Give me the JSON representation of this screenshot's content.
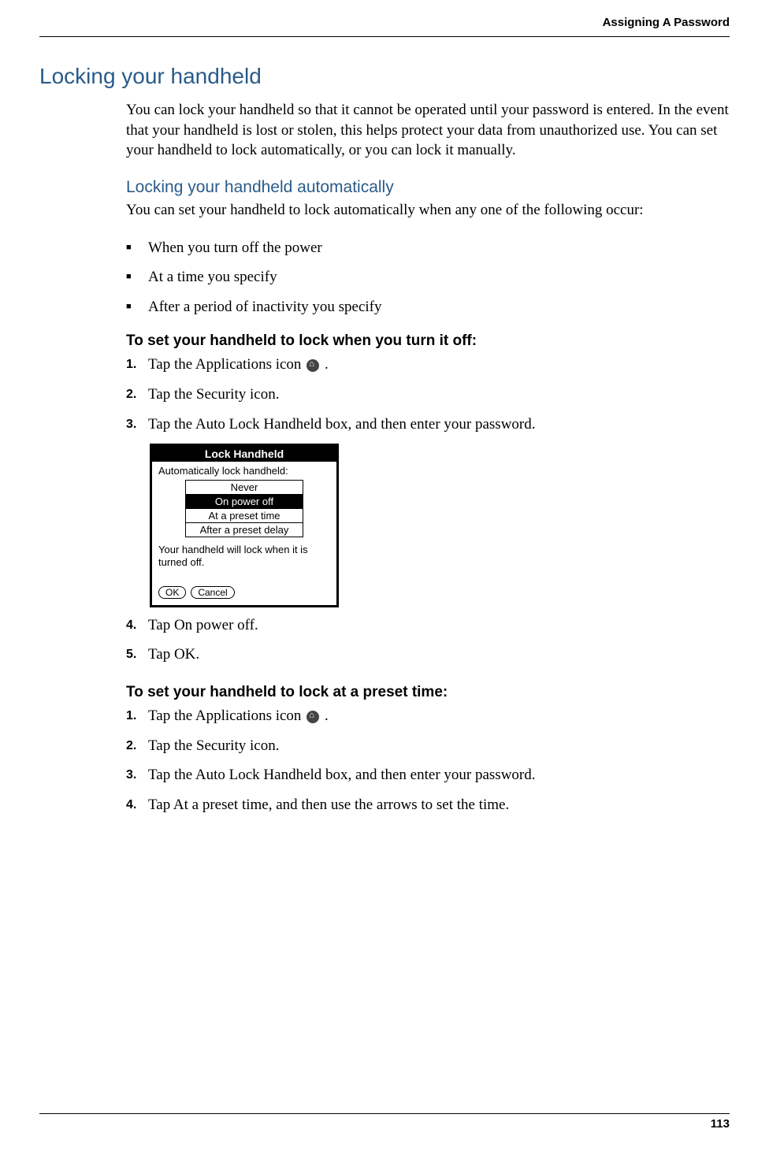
{
  "header": {
    "section_name": "Assigning A Password"
  },
  "main": {
    "title": "Locking your handheld",
    "intro": "You can lock your handheld so that it cannot be operated until your password is entered. In the event that your handheld is lost or stolen, this helps protect your data from unauthorized use. You can set your handheld to lock automatically, or you can lock it manually.",
    "auto_section": {
      "title": "Locking your handheld automatically",
      "intro": "You can set your handheld to lock automatically when any one of the following occur:",
      "bullets": [
        "When you turn off the power",
        "At a time you specify",
        "After a period of inactivity you specify"
      ]
    },
    "procedure1": {
      "title": "To set your handheld to lock when you turn it off:",
      "steps": [
        "Tap the Applications icon ",
        "Tap the Security icon.",
        "Tap the Auto Lock Handheld box, and then enter your password."
      ],
      "steps_after": [
        "Tap On power off.",
        "Tap OK."
      ]
    },
    "dialog": {
      "title": "Lock Handheld",
      "label": "Automatically lock handheld:",
      "options": [
        "Never",
        "On power off",
        "At a preset time",
        "After a preset delay"
      ],
      "selected_index": 1,
      "hint": "Your handheld will lock when it is turned off.",
      "ok": "OK",
      "cancel": "Cancel"
    },
    "procedure2": {
      "title": "To set your handheld to lock at a preset time:",
      "steps": [
        "Tap the Applications icon ",
        "Tap the Security icon.",
        "Tap the Auto Lock Handheld box, and then enter your password.",
        "Tap At a preset time, and then use the arrows to set the time."
      ]
    }
  },
  "footer": {
    "page_number": "113"
  }
}
